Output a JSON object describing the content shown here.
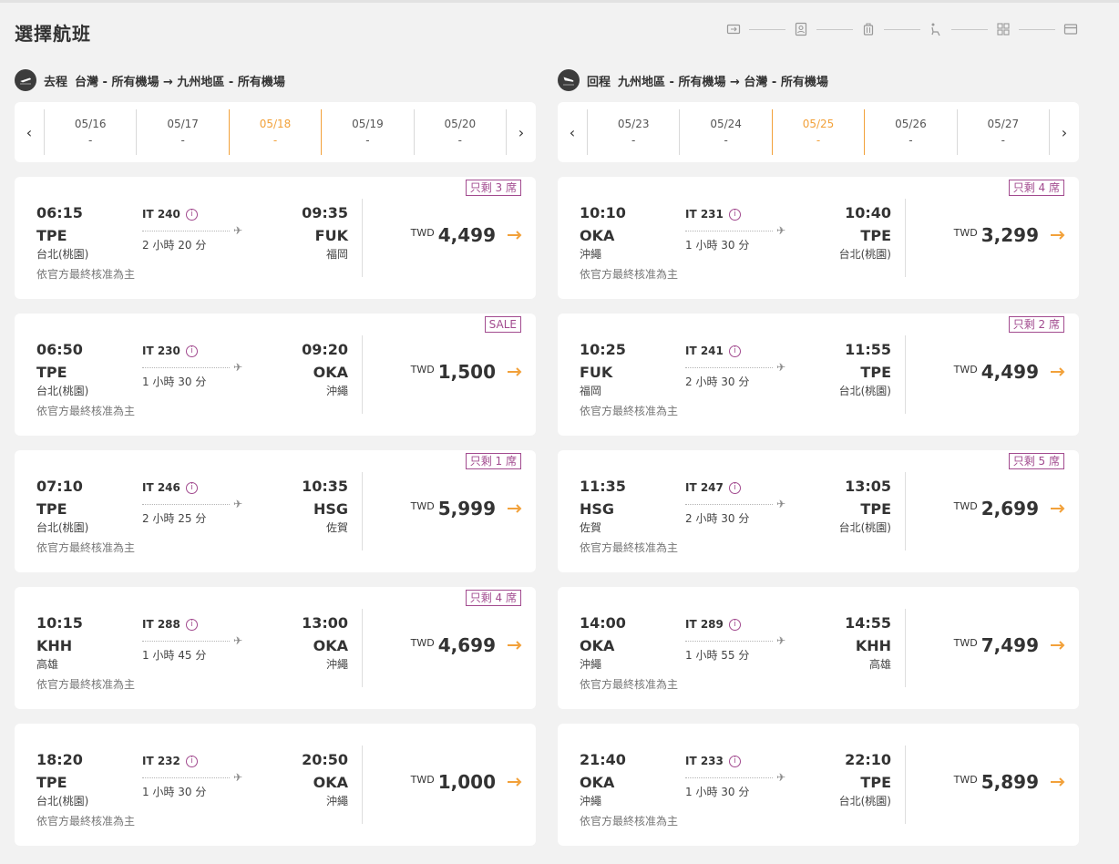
{
  "page": {
    "title": "選擇航班"
  },
  "steps": [
    "ticket-icon",
    "passenger-icon",
    "baggage-icon",
    "seat-icon",
    "addons-icon",
    "payment-icon"
  ],
  "outbound": {
    "direction": "去程",
    "route": "台灣 - 所有機場 → 九州地區 - 所有機場",
    "dates": [
      {
        "date": "05/16",
        "price": "-"
      },
      {
        "date": "05/17",
        "price": "-"
      },
      {
        "date": "05/18",
        "price": "-",
        "active": true
      },
      {
        "date": "05/19",
        "price": "-"
      },
      {
        "date": "05/20",
        "price": "-"
      }
    ],
    "flights": [
      {
        "badge": "只剩 3 席",
        "dep_time": "06:15",
        "dep_code": "TPE",
        "dep_city": "台北(桃園)",
        "flight_no": "IT 240",
        "duration": "2 小時 20 分",
        "arr_time": "09:35",
        "arr_code": "FUK",
        "arr_city": "福岡",
        "currency": "TWD",
        "price": "4,499",
        "note": "依官方最終核准為主"
      },
      {
        "badge": "SALE",
        "dep_time": "06:50",
        "dep_code": "TPE",
        "dep_city": "台北(桃園)",
        "flight_no": "IT 230",
        "duration": "1 小時 30 分",
        "arr_time": "09:20",
        "arr_code": "OKA",
        "arr_city": "沖繩",
        "currency": "TWD",
        "price": "1,500",
        "note": "依官方最終核准為主"
      },
      {
        "badge": "只剩 1 席",
        "dep_time": "07:10",
        "dep_code": "TPE",
        "dep_city": "台北(桃園)",
        "flight_no": "IT 246",
        "duration": "2 小時 25 分",
        "arr_time": "10:35",
        "arr_code": "HSG",
        "arr_city": "佐賀",
        "currency": "TWD",
        "price": "5,999",
        "note": "依官方最終核准為主"
      },
      {
        "badge": "只剩 4 席",
        "dep_time": "10:15",
        "dep_code": "KHH",
        "dep_city": "高雄",
        "flight_no": "IT 288",
        "duration": "1 小時 45 分",
        "arr_time": "13:00",
        "arr_code": "OKA",
        "arr_city": "沖繩",
        "currency": "TWD",
        "price": "4,699",
        "note": "依官方最終核准為主"
      },
      {
        "badge": "",
        "dep_time": "18:20",
        "dep_code": "TPE",
        "dep_city": "台北(桃園)",
        "flight_no": "IT 232",
        "duration": "1 小時 30 分",
        "arr_time": "20:50",
        "arr_code": "OKA",
        "arr_city": "沖繩",
        "currency": "TWD",
        "price": "1,000",
        "note": "依官方最終核准為主"
      }
    ]
  },
  "inbound": {
    "direction": "回程",
    "route": "九州地區 - 所有機場 → 台灣 - 所有機場",
    "dates": [
      {
        "date": "05/23",
        "price": "-"
      },
      {
        "date": "05/24",
        "price": "-"
      },
      {
        "date": "05/25",
        "price": "-",
        "active": true
      },
      {
        "date": "05/26",
        "price": "-"
      },
      {
        "date": "05/27",
        "price": "-"
      }
    ],
    "flights": [
      {
        "badge": "只剩 4 席",
        "dep_time": "10:10",
        "dep_code": "OKA",
        "dep_city": "沖繩",
        "flight_no": "IT 231",
        "duration": "1 小時 30 分",
        "arr_time": "10:40",
        "arr_code": "TPE",
        "arr_city": "台北(桃園)",
        "currency": "TWD",
        "price": "3,299",
        "note": "依官方最終核准為主"
      },
      {
        "badge": "只剩 2 席",
        "dep_time": "10:25",
        "dep_code": "FUK",
        "dep_city": "福岡",
        "flight_no": "IT 241",
        "duration": "2 小時 30 分",
        "arr_time": "11:55",
        "arr_code": "TPE",
        "arr_city": "台北(桃園)",
        "currency": "TWD",
        "price": "4,499",
        "note": "依官方最終核准為主"
      },
      {
        "badge": "只剩 5 席",
        "dep_time": "11:35",
        "dep_code": "HSG",
        "dep_city": "佐賀",
        "flight_no": "IT 247",
        "duration": "2 小時 30 分",
        "arr_time": "13:05",
        "arr_code": "TPE",
        "arr_city": "台北(桃園)",
        "currency": "TWD",
        "price": "2,699",
        "note": "依官方最終核准為主"
      },
      {
        "badge": "",
        "dep_time": "14:00",
        "dep_code": "OKA",
        "dep_city": "沖繩",
        "flight_no": "IT 289",
        "duration": "1 小時 55 分",
        "arr_time": "14:55",
        "arr_code": "KHH",
        "arr_city": "高雄",
        "currency": "TWD",
        "price": "7,499",
        "note": "依官方最終核准為主"
      },
      {
        "badge": "",
        "dep_time": "21:40",
        "dep_code": "OKA",
        "dep_city": "沖繩",
        "flight_no": "IT 233",
        "duration": "1 小時 30 分",
        "arr_time": "22:10",
        "arr_code": "TPE",
        "arr_city": "台北(桃園)",
        "currency": "TWD",
        "price": "5,899",
        "note": "依官方最終核准為主"
      }
    ]
  },
  "colors": {
    "accent": "#f2a13a",
    "badge": "#a24b8f",
    "bg": "#f2f2f2"
  }
}
